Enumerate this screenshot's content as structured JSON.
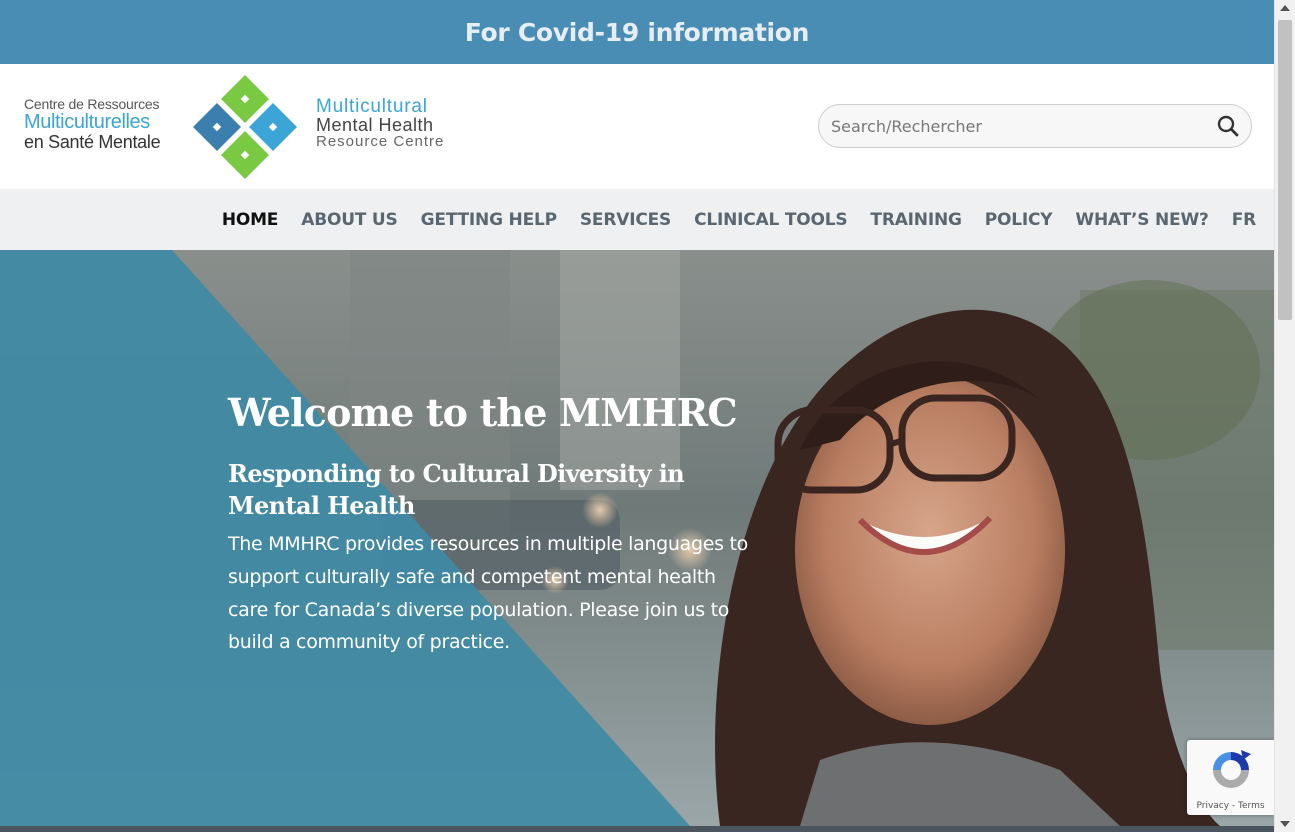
{
  "covid_banner": {
    "text": "For Covid-19 information"
  },
  "logo": {
    "fr_line1": "Centre de Ressources",
    "fr_line2": "Multiculturelles",
    "fr_line3": "en Santé Mentale",
    "en_line1": "Multicultural",
    "en_line2": "Mental Health",
    "en_line3": "Resource Centre",
    "colors": {
      "green": "#7ac943",
      "blue_dark": "#3b7fae",
      "blue_light": "#3aa5d6"
    }
  },
  "search": {
    "placeholder": "Search/Rechercher",
    "value": "",
    "icon": "search-icon"
  },
  "nav": {
    "items": [
      {
        "label": "HOME",
        "active": true
      },
      {
        "label": "ABOUT US",
        "active": false
      },
      {
        "label": "GETTING HELP",
        "active": false
      },
      {
        "label": "SERVICES",
        "active": false
      },
      {
        "label": "CLINICAL TOOLS",
        "active": false
      },
      {
        "label": "TRAINING",
        "active": false
      },
      {
        "label": "POLICY",
        "active": false
      },
      {
        "label": "WHAT’S NEW?",
        "active": false
      },
      {
        "label": "FR",
        "active": false
      }
    ]
  },
  "hero": {
    "title": "Welcome to the MMHRC",
    "subtitle": "Responding to Cultural Diversity in Mental Health",
    "body": "The MMHRC provides resources in multiple languages to support culturally safe and competent mental health care for Canada’s diverse population. Please join us to build a community of practice.",
    "overlay_color": "#3f8aa5"
  },
  "recaptcha": {
    "links": "Privacy - Terms"
  },
  "colors": {
    "banner": "#4a8db4",
    "nav_bg": "#eef0f2",
    "nav_text": "#5b6770",
    "nav_active": "#111111"
  }
}
